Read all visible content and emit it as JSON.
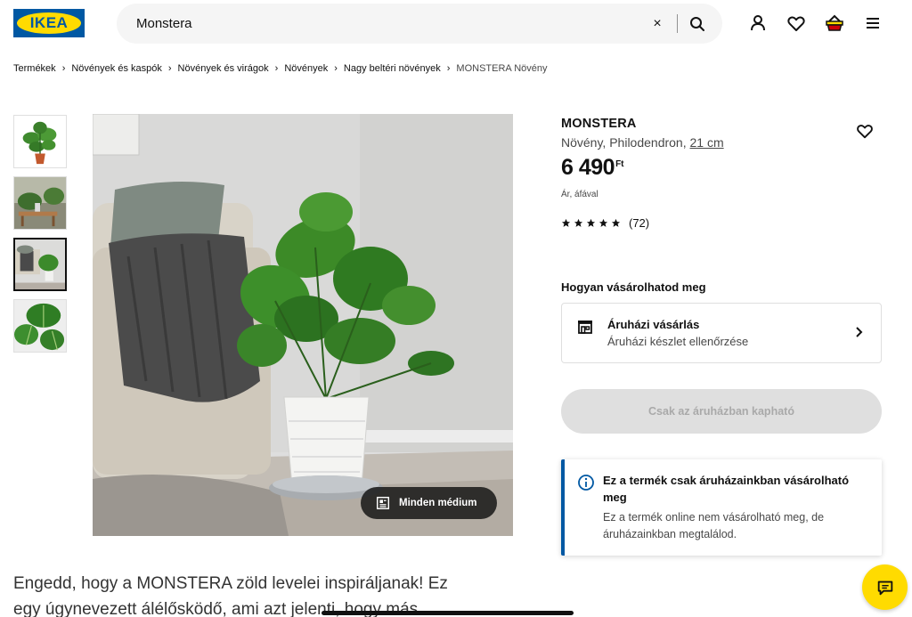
{
  "header": {
    "logo_text": "IKEA",
    "search": {
      "value": "Monstera",
      "clear_label": "×"
    }
  },
  "breadcrumb": {
    "items": [
      "Termékek",
      "Növények és kaspók",
      "Növények és virágok",
      "Növények",
      "Nagy beltéri növények",
      "MONSTERA Növény"
    ]
  },
  "gallery": {
    "media_button_label": "Minden médium"
  },
  "product": {
    "name": "MONSTERA",
    "description": "Növény, Philodendron,",
    "size": "21 cm",
    "price": "6 490",
    "currency": "Ft",
    "vat_note": "Ár, áfával",
    "rating": {
      "stars": 5,
      "reviews": "(72)"
    }
  },
  "purchase": {
    "title": "Hogyan vásárolhatod meg",
    "store_option": {
      "title": "Áruházi vásárlás",
      "subtitle": "Áruházi készlet ellenőrzése"
    },
    "cta_label": "Csak az áruházban kapható"
  },
  "notice": {
    "title": "Ez a termék csak áruházainkban vásárolható meg",
    "body": "Ez a termék online nem vásárolható meg, de áruházainkban megtalálod."
  },
  "description_text": "Engedd, hogy a MONSTERA zöld levelei inspiráljanak! Ez egy úgynevezett álélősködő, ami azt jelenti, hogy más",
  "colors": {
    "ikea_blue": "#0058a3",
    "ikea_yellow": "#ffdb00",
    "text": "#111111",
    "muted": "#484848"
  }
}
